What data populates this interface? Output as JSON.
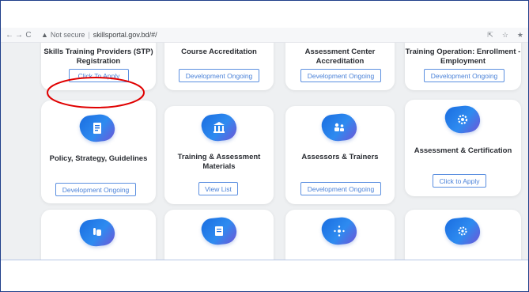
{
  "browser": {
    "security_label": "Not secure",
    "url": "skillsportal.gov.bd/#/"
  },
  "cards_row1": [
    {
      "title": "Skills Training Providers (STP) Registration",
      "button": "Click To Apply"
    },
    {
      "title": "Course Accreditation",
      "button": "Development Ongoing"
    },
    {
      "title": "Assessment Center Accreditation",
      "button": "Development Ongoing"
    },
    {
      "title": "Training Operation: Enrollment - Employment",
      "button": "Development Ongoing"
    }
  ],
  "cards_row2": [
    {
      "title": "Policy, Strategy, Guidelines",
      "button": "Development Ongoing",
      "icon": "document-icon"
    },
    {
      "title": "Training & Assessment Materials",
      "button": "View List",
      "icon": "building-icon"
    },
    {
      "title": "Assessors & Trainers",
      "button": "Development Ongoing",
      "icon": "users-icon"
    },
    {
      "title": "Assessment & Certification",
      "button": "Click to Apply",
      "icon": "gear-icon"
    }
  ],
  "cards_row3": [
    {
      "icon": "hand-icon"
    },
    {
      "icon": "book-icon"
    },
    {
      "icon": "network-icon"
    },
    {
      "icon": "settings-icon"
    }
  ],
  "colors": {
    "accent_blue": "#4b82d8",
    "annotation_red": "#e00000",
    "frame_border": "#1f3f8a"
  }
}
